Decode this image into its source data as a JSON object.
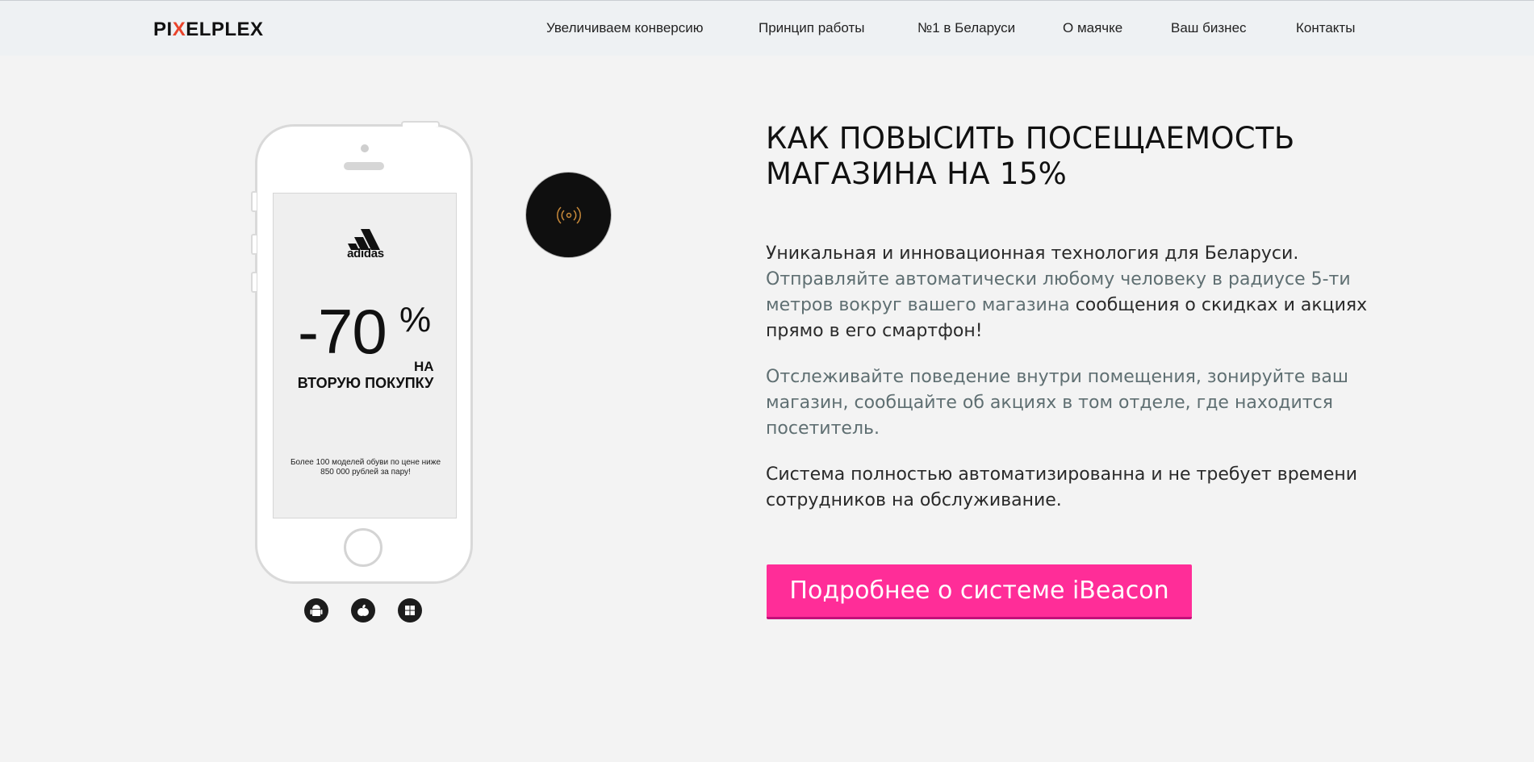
{
  "brand": {
    "logo_pre": "PI",
    "logo_x": "X",
    "logo_post": "ELPLEX"
  },
  "nav": [
    {
      "label": "Увеличиваем конверсию"
    },
    {
      "label": "Принцип работы"
    },
    {
      "label": "№1 в Беларуси"
    },
    {
      "label": "О маячке"
    },
    {
      "label": "Ваш бизнес"
    },
    {
      "label": "Контакты"
    }
  ],
  "phone": {
    "brand": "adidas",
    "discount": "-70",
    "percent": "%",
    "na": "НА",
    "purchase": "ВТОРУЮ ПОКУПКУ",
    "fine_print": "Более 100 моделей обуви по цене ниже 850 000 рублей за пару!"
  },
  "os_icons": [
    "android-icon",
    "apple-icon",
    "windows-icon"
  ],
  "hero": {
    "title_line1": "КАК ПОВЫСИТЬ ПОСЕЩАЕМОСТЬ",
    "title_line2": "МАГАЗИНА НА 15%",
    "p1_a": "Уникальная и инновационная технология для Беларуси.",
    "p1_b": "Отправляйте автоматически любому человеку в радиусе 5-ти метров вокруг вашего магазина",
    "p1_c": "сообщения о скидках и акциях прямо в его смартфон!",
    "p2": "Отслеживайте поведение внутри помещения, зонируйте ваш магазин, сообщайте об акциях в том отделе, где находится посетитель.",
    "p3": "Система полностью автоматизированна и не требует времени сотрудников на обслуживание.",
    "cta": "Подробнее о системе iBeacon"
  },
  "colors": {
    "accent": "#ff2d98",
    "logo_x": "#e9442b",
    "muted_text": "#5f6f72"
  }
}
